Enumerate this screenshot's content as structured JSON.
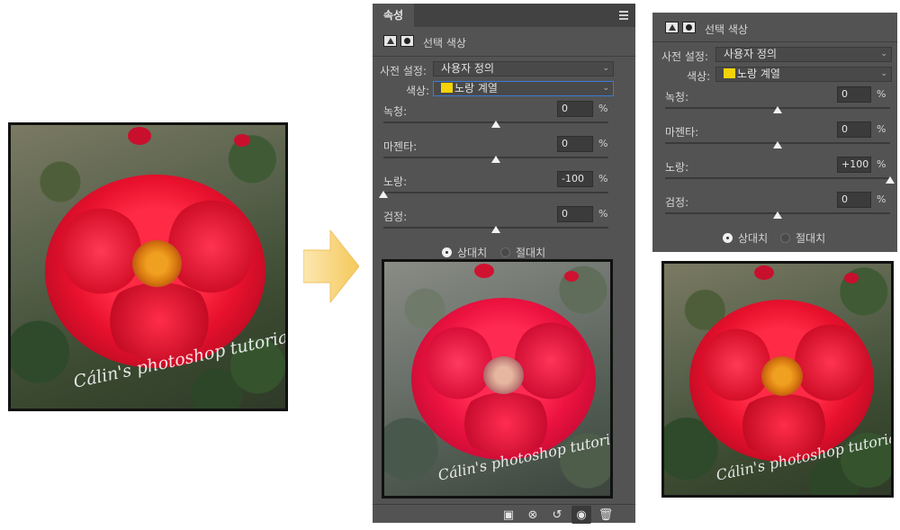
{
  "panel": {
    "tab_label": "속성",
    "header_title": "선택 색상",
    "preset_label": "사전 설정:",
    "preset_value": "사용자 정의",
    "color_label": "색상:",
    "color_value": "노랑 계열",
    "swatch_color": "#f5d30a",
    "sliders": [
      {
        "label": "녹청:",
        "value": "0",
        "unit": "%",
        "level": 0
      },
      {
        "label": "마젠타:",
        "value": "0",
        "unit": "%",
        "level": 0
      },
      {
        "label": "노랑:",
        "value": "-100",
        "unit": "%",
        "level": -100
      },
      {
        "label": "검정:",
        "value": "0",
        "unit": "%",
        "level": 0
      }
    ],
    "radio_relative": "상대치",
    "radio_absolute": "절대치",
    "selected_method": "relative",
    "footer_icons": [
      "clip-to-layer-icon",
      "view-previous-state-icon",
      "reset-icon",
      "visibility-eye-icon",
      "trash-icon"
    ]
  },
  "panel2": {
    "header_title": "선택 색상",
    "preset_label": "사전 설정:",
    "preset_value": "사용자 정의",
    "color_label": "색상:",
    "color_value": "노랑 계열",
    "sliders": [
      {
        "label": "녹청:",
        "value": "0",
        "unit": "%",
        "level": 0
      },
      {
        "label": "마젠타:",
        "value": "0",
        "unit": "%",
        "level": 0
      },
      {
        "label": "노랑:",
        "value": "+100",
        "unit": "%",
        "level": 100
      },
      {
        "label": "검정:",
        "value": "0",
        "unit": "%",
        "level": 0
      }
    ],
    "radio_relative": "상대치",
    "radio_absolute": "절대치",
    "selected_method": "relative"
  },
  "watermark": "Cálin's photoshop tutorial",
  "colors": {
    "panel_bg": "#535353",
    "arrow": "#f7d47a",
    "rose_red": "#e8112d"
  }
}
